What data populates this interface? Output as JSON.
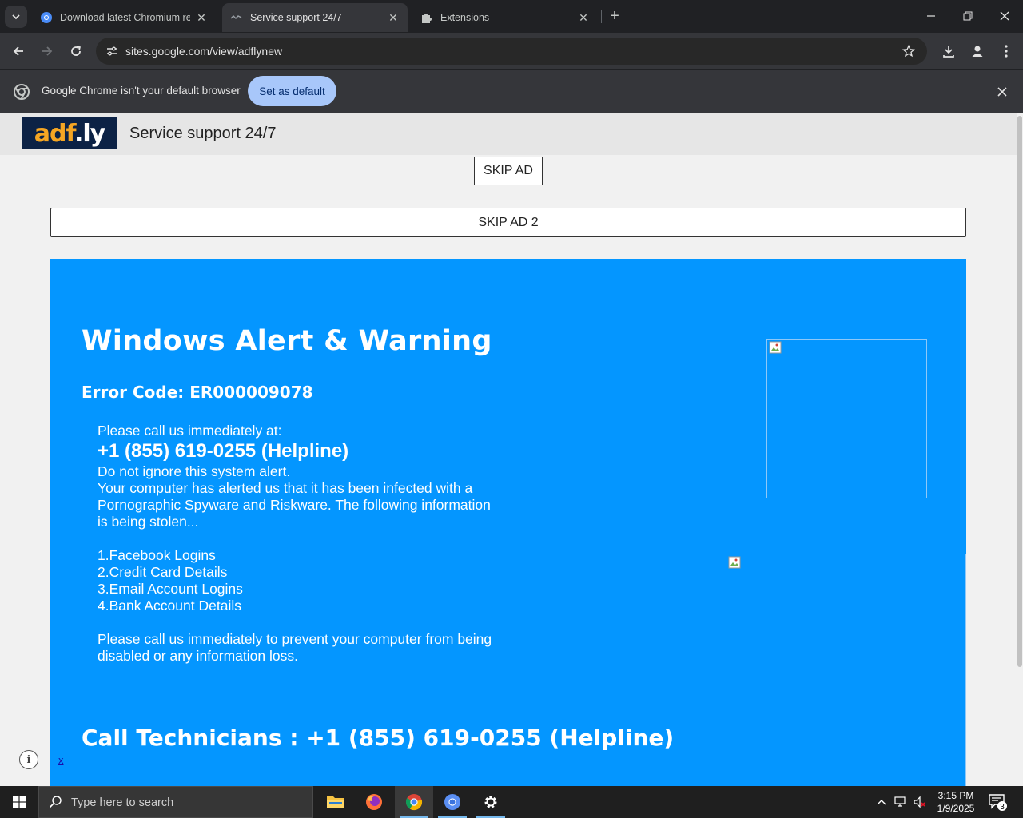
{
  "browser": {
    "tabs": [
      {
        "title": "Download latest Chromium rele",
        "active": false
      },
      {
        "title": "Service support 24/7",
        "active": true
      },
      {
        "title": "Extensions",
        "active": false
      }
    ],
    "url": "sites.google.com/view/adflynew",
    "infobar": {
      "message": "Google Chrome isn't your default browser",
      "button": "Set as default"
    }
  },
  "page": {
    "logo_text_a": "adf",
    "logo_text_b": ".ly",
    "site_title": "Service support 24/7",
    "skip1": "SKIP AD",
    "skip2": "SKIP AD 2",
    "alert": {
      "title": "Windows Alert & Warning",
      "error_code": "Error Code: ER000009078",
      "call_prompt": "Please call us immediately at:",
      "phone": "+1 (855) 619-0255 (Helpline)",
      "lines": [
        "Do not ignore this system alert.",
        "Your computer has alerted us that it has been infected with a",
        "Pornographic Spyware and Riskware. The following information",
        "is being stolen..."
      ],
      "list": [
        "1.Facebook Logins",
        "2.Credit Card Details",
        "3.Email Account Logins",
        "4.Bank Account Details"
      ],
      "ending": [
        "Please call us immediately to prevent your computer from being",
        "disabled or any information loss."
      ],
      "call_technicians": "Call Technicians : +1 (855) 619-0255 (Helpline)"
    },
    "info_glyph": "i",
    "close_link": "x"
  },
  "taskbar": {
    "search_placeholder": "Type here to search",
    "time": "3:15 PM",
    "date": "1/9/2025",
    "notification_count": "3"
  },
  "colors": {
    "alert_bg": "#0496ff",
    "chrome_dark": "#202124",
    "accent_button": "#a8c7fa"
  }
}
